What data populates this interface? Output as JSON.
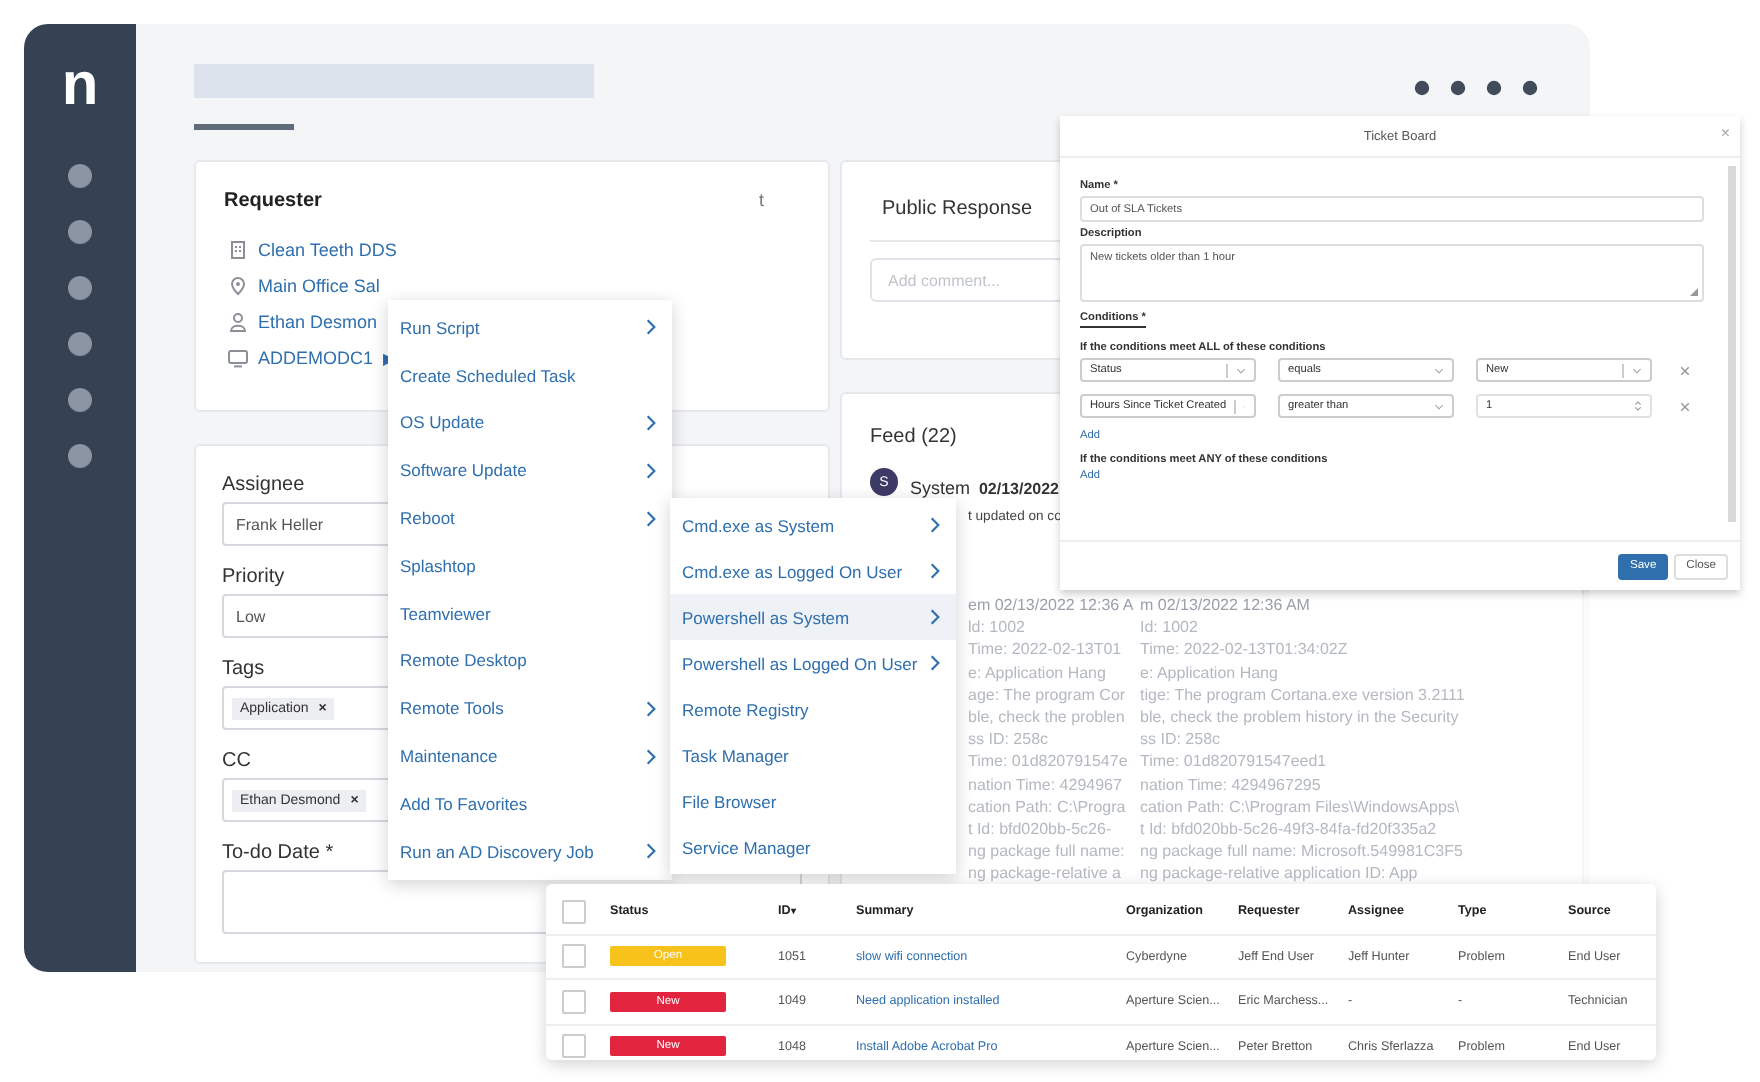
{
  "sidebar": {
    "logo": "n"
  },
  "requester": {
    "title": "Requester",
    "corner": "t",
    "rows": [
      {
        "kind": "building",
        "text": "Clean Teeth DDS"
      },
      {
        "kind": "pin",
        "text": "Main Office Sal"
      },
      {
        "kind": "person",
        "text": "Ethan Desmon"
      },
      {
        "kind": "monitor",
        "text": "ADDEMODC1",
        "marker": "▶"
      }
    ]
  },
  "form": [
    {
      "kind": "text",
      "label": "Assignee",
      "value": "Frank Heller"
    },
    {
      "kind": "text",
      "label": "Priority",
      "value": "Low"
    },
    {
      "kind": "chips",
      "label": "Tags",
      "chips": [
        {
          "text": "Application",
          "remove": "×"
        }
      ]
    },
    {
      "kind": "chips",
      "label": "CC",
      "chips": [
        {
          "text": "Ethan Desmond",
          "remove": "×"
        }
      ]
    },
    {
      "kind": "date",
      "label": "To-do Date *"
    }
  ],
  "public_response": {
    "title": "Public Response",
    "placeholder": "Add comment..."
  },
  "feed": {
    "title": "Feed (22)",
    "avatar": "S",
    "author": "System",
    "date": "02/13/2022",
    "text": "t updated on co"
  },
  "context_menu": [
    {
      "label": "Run Script",
      "submenu": true
    },
    {
      "label": "Create Scheduled Task",
      "submenu": false
    },
    {
      "label": "OS Update",
      "submenu": true
    },
    {
      "label": "Software Update",
      "submenu": true
    },
    {
      "label": "Reboot",
      "submenu": true
    },
    {
      "label": "Splashtop",
      "submenu": false
    },
    {
      "label": "Teamviewer",
      "submenu": false
    },
    {
      "label": "Remote Desktop",
      "submenu": false
    },
    {
      "label": "Remote Tools",
      "submenu": true
    },
    {
      "label": "Maintenance",
      "submenu": true
    },
    {
      "label": "Add To Favorites",
      "submenu": false
    },
    {
      "label": "Run an AD Discovery Job",
      "submenu": true
    }
  ],
  "submenu": [
    {
      "label": "Cmd.exe as System",
      "submenu": true,
      "selected": false
    },
    {
      "label": "Cmd.exe as Logged On User",
      "submenu": true,
      "selected": false
    },
    {
      "label": "Powershell as System",
      "submenu": true,
      "selected": true
    },
    {
      "label": "Powershell as Logged On User",
      "submenu": true,
      "selected": false
    },
    {
      "label": "Remote Registry",
      "submenu": false,
      "selected": false
    },
    {
      "label": "Task Manager",
      "submenu": false,
      "selected": false
    },
    {
      "label": "File Browser",
      "submenu": false,
      "selected": false
    },
    {
      "label": "Service Manager",
      "submenu": false,
      "selected": false
    }
  ],
  "log": [
    {
      "ghost": "em  02/13/2022 12:36 A",
      "text": "m  02/13/2022 12:36 AM",
      "kind": "header"
    },
    {
      "ghost": "ld: 1002",
      "text": "Id: 1002",
      "kind": "line"
    },
    {
      "ghost": "Time: 2022-02-13T01",
      "text": "Time: 2022-02-13T01:34:02Z",
      "kind": "line"
    },
    {
      "ghost": "e: Application Hang",
      "text": "e: Application Hang",
      "kind": "line"
    },
    {
      "ghost": "age: The program Cor",
      "text": "tige: The program Cortana.exe version 3.2111",
      "kind": "line"
    },
    {
      "ghost": "ble, check the problen",
      "text": "ble, check the problem history in the Security",
      "kind": "line"
    },
    {
      "ghost": "ss ID: 258c",
      "text": "ss ID: 258c",
      "kind": "line"
    },
    {
      "ghost": "Time: 01d820791547e",
      "text": "Time: 01d820791547eed1",
      "kind": "line"
    },
    {
      "ghost": "nation Time: 4294967",
      "text": "nation Time: 4294967295",
      "kind": "line"
    },
    {
      "ghost": "cation Path: C:\\Progra",
      "text": "cation Path: C:\\Program Files\\WindowsApps\\",
      "kind": "line"
    },
    {
      "ghost": "t Id: bfd020bb-5c26-",
      "text": "t Id: bfd020bb-5c26-49f3-84fa-fd20f335a2",
      "kind": "line"
    },
    {
      "ghost": "ng package full name:",
      "text": "ng package full name: Microsoft.549981C3F5",
      "kind": "line"
    },
    {
      "ghost": "ng package-relative a",
      "text": "ng package-relative application ID: App",
      "kind": "line"
    }
  ],
  "modal": {
    "title": "Ticket Board",
    "close": "×",
    "name_label": "Name *",
    "name_value": "Out of SLA Tickets",
    "description_label": "Description",
    "description_value": "New tickets older than 1 hour",
    "conditions_tab": "Conditions *",
    "all_label": "If the conditions meet ALL of these conditions",
    "conditions": [
      [
        {
          "kind": "select",
          "value": "Status",
          "clearable": true
        },
        {
          "kind": "select",
          "value": "equals",
          "clearable": false
        },
        {
          "kind": "select",
          "value": "New",
          "clearable": true
        }
      ],
      [
        {
          "kind": "select",
          "value": "Hours Since Ticket Created",
          "clearable": true
        },
        {
          "kind": "select",
          "value": "greater than",
          "clearable": false
        },
        {
          "kind": "number",
          "value": "1",
          "clearable": false
        }
      ]
    ],
    "add_all": "Add",
    "any_label": "If the conditions meet ANY of these conditions",
    "add_any": "Add",
    "buttons": [
      {
        "label": "Save",
        "kind": "primary"
      },
      {
        "label": "Close",
        "kind": "secondary"
      }
    ]
  },
  "table": {
    "header_checked": false,
    "columns": [
      "Status",
      "ID",
      "Summary",
      "Organization",
      "Requester",
      "Assignee",
      "Type",
      "Source"
    ],
    "sort_mark": "▾",
    "rows": [
      {
        "checked": false,
        "status": "Open",
        "color": "#f7c21a",
        "id": "1051",
        "summary": "slow wifi connection",
        "organization": "Cyberdyne",
        "requester": "Jeff End User",
        "assignee": "Jeff Hunter",
        "type": "Problem",
        "source": "End User"
      },
      {
        "checked": false,
        "status": "New",
        "color": "#e3243f",
        "id": "1049",
        "summary": "Need application installed",
        "organization": "Aperture Scien...",
        "requester": "Eric Marchess...",
        "assignee": "-",
        "type": "-",
        "source": "Technician"
      },
      {
        "checked": false,
        "status": "New",
        "color": "#e3243f",
        "id": "1048",
        "summary": "Install Adobe Acrobat Pro",
        "organization": "Aperture Scien...",
        "requester": "Peter Bretton",
        "assignee": "Chris Sferlazza",
        "type": "Problem",
        "source": "End User"
      }
    ]
  }
}
